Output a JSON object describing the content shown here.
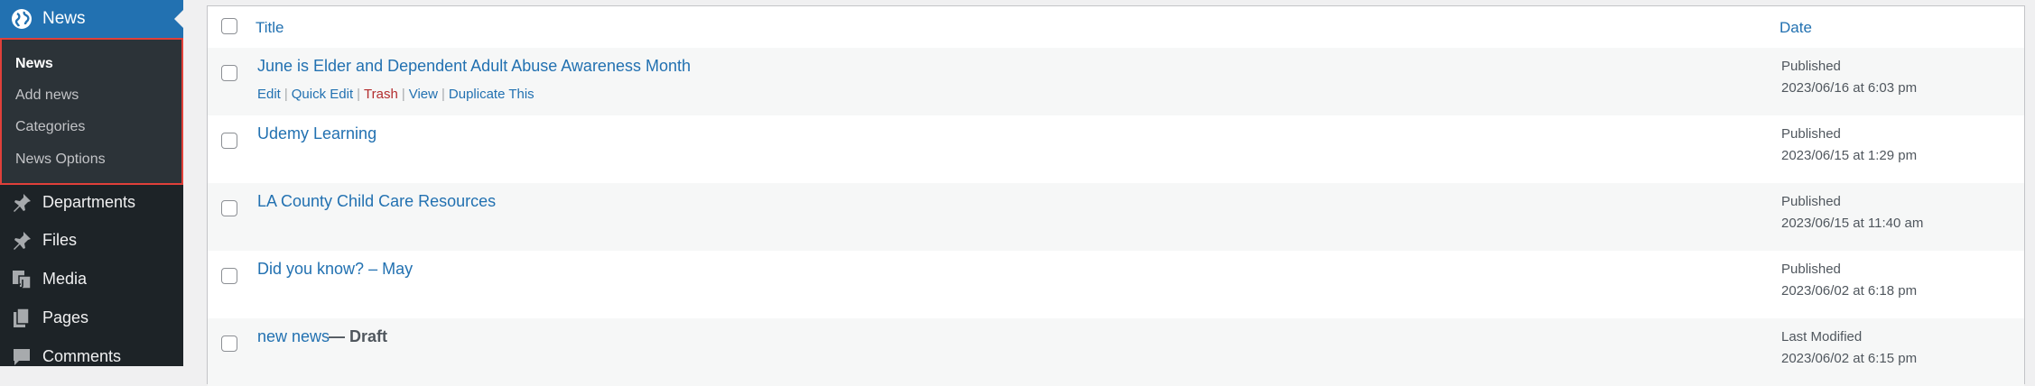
{
  "sidebar": {
    "active_menu": {
      "label": "News",
      "icon": "globe-icon"
    },
    "submenu": [
      {
        "label": "News",
        "current": true
      },
      {
        "label": "Add news",
        "current": false
      },
      {
        "label": "Categories",
        "current": false
      },
      {
        "label": "News Options",
        "current": false
      }
    ],
    "items": [
      {
        "label": "Departments",
        "icon": "pin-icon"
      },
      {
        "label": "Files",
        "icon": "pin-icon"
      },
      {
        "label": "Media",
        "icon": "media-icon"
      },
      {
        "label": "Pages",
        "icon": "pages-icon"
      },
      {
        "label": "Comments",
        "icon": "comment-icon"
      }
    ],
    "colors": {
      "background": "#1d2327",
      "active": "#2271b1",
      "submenu_bg": "#2c3338",
      "highlight_border": "#e0403a"
    }
  },
  "table": {
    "headers": {
      "title": "Title",
      "date": "Date"
    },
    "row_actions": {
      "edit": "Edit",
      "quick_edit": "Quick Edit",
      "trash": "Trash",
      "view": "View",
      "duplicate": "Duplicate This",
      "separator": "|"
    },
    "rows": [
      {
        "title": "June is Elder and Dependent Adult Abuse Awareness Month",
        "status": "Published",
        "date": "2023/06/16 at 6:03 pm"
      },
      {
        "title": "Udemy Learning",
        "status": "Published",
        "date": "2023/06/15 at 1:29 pm"
      },
      {
        "title": "LA County Child Care Resources",
        "status": "Published",
        "date": "2023/06/15 at 11:40 am"
      },
      {
        "title": "Did you know? – May",
        "status": "Published",
        "date": "2023/06/02 at 6:18 pm"
      },
      {
        "title": "new news",
        "state": " — Draft",
        "status": "Last Modified",
        "date": "2023/06/02 at 6:15 pm"
      }
    ]
  }
}
